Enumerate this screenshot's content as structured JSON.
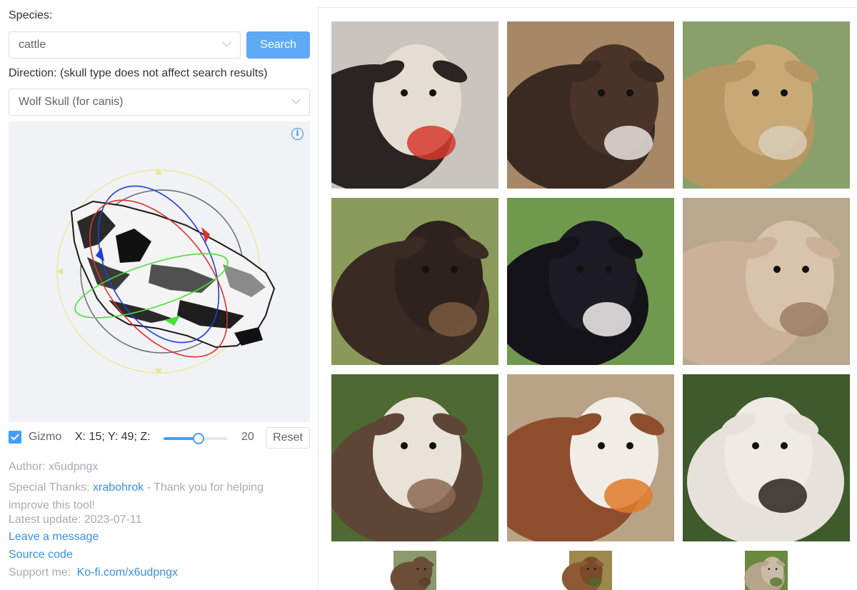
{
  "search": {
    "species_label": "Species:",
    "species_value": "cattle",
    "search_button": "Search",
    "direction_label": "Direction: (skull type does not affect search results)",
    "direction_value": "Wolf Skull (for canis)"
  },
  "viewer": {
    "info_icon": "info-icon",
    "gizmo_label": "Gizmo",
    "gizmo_checked": true,
    "coords": "X: 15; Y: 49; Z:",
    "slider_value": "20",
    "slider_fraction": 0.55,
    "reset_button": "Reset"
  },
  "footer": {
    "author": "Author: x6udpngx",
    "thanks_prefix": "Special Thanks: ",
    "thanks_name": "xrabohrok",
    "thanks_suffix": " - Thank you for helping",
    "thanks_line2": "improve this tool!",
    "latest_update": "Latest update: 2023-07-11",
    "leave_message": "Leave a message",
    "source_code": "Source code",
    "support_prefix": "Support me:",
    "support_link": "Ko-fi.com/x6udpngx"
  },
  "colors": {
    "accent": "#409eff",
    "link": "#3a8ee6",
    "muted": "#a8abb2"
  },
  "gallery": [
    {
      "name": "cattle-photo-1",
      "bg": "#c9c4bd",
      "body": "#2a2522",
      "face": "#e4ddd3",
      "accent": "#d63a2f"
    },
    {
      "name": "cattle-photo-2",
      "bg": "#a68766",
      "body": "#3a2a22",
      "face": "#4a3328",
      "accent": "#e7e3de"
    },
    {
      "name": "cattle-photo-3",
      "bg": "#8aa06a",
      "body": "#b89661",
      "face": "#c9aa77",
      "accent": "#d8cdb8"
    },
    {
      "name": "cattle-photo-4",
      "bg": "#8a9a5a",
      "body": "#3a2a24",
      "face": "#2e221d",
      "accent": "#7a5a3e"
    },
    {
      "name": "cattle-photo-5",
      "bg": "#6f9a4e",
      "body": "#15131a",
      "face": "#1c1a22",
      "accent": "#f2f0ee"
    },
    {
      "name": "cattle-photo-6",
      "bg": "#b8a88c",
      "body": "#cbb197",
      "face": "#d8c3ad",
      "accent": "#9c7e66"
    },
    {
      "name": "cattle-photo-7",
      "bg": "#4e6a32",
      "body": "#5e4636",
      "face": "#e8e2d8",
      "accent": "#8a6a52"
    },
    {
      "name": "cattle-photo-8",
      "bg": "#b9a386",
      "body": "#8e4e2e",
      "face": "#f1ede6",
      "accent": "#e07a2a"
    },
    {
      "name": "cattle-photo-9",
      "bg": "#3f5a2c",
      "body": "#e6e2da",
      "face": "#efebe4",
      "accent": "#2a2420"
    },
    {
      "name": "cattle-photo-10",
      "bg": "#8a9a6a",
      "body": "#6a4e36",
      "face": "#6a4e36",
      "accent": "#5a4030"
    },
    {
      "name": "cattle-photo-11",
      "bg": "#9c8a4a",
      "body": "#8e5a36",
      "face": "#7a4a2a",
      "accent": "#4e6a2e"
    },
    {
      "name": "cattle-photo-12",
      "bg": "#6a8a3e",
      "body": "#b4a48a",
      "face": "#c9bca6",
      "accent": "#5e7a36"
    }
  ]
}
